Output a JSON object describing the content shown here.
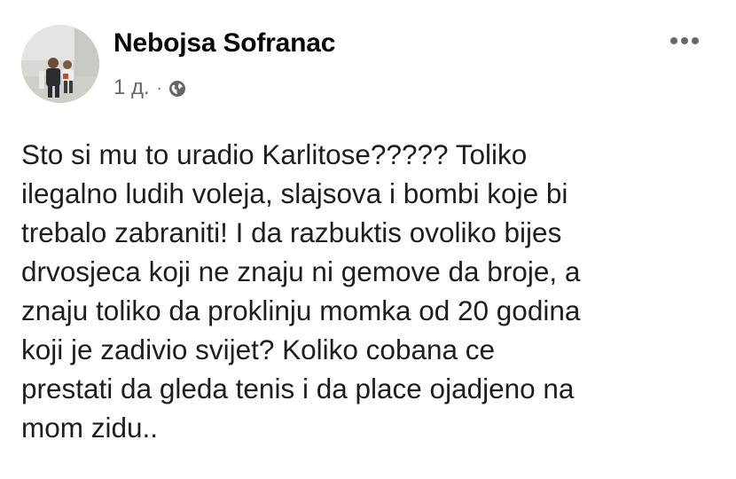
{
  "post": {
    "author": "Nebojsa Sofranac",
    "timestamp": "1 д.",
    "separator": "·",
    "privacy_icon": "globe-icon",
    "more_icon": "more-options-icon",
    "text_lines": [
      "Sto si mu to uradio Karlitose????? Toliko",
      "ilegalno ludih voleja, slajsova i bombi koje bi",
      "trebalo zabraniti! I da razbuktis ovoliko bijes",
      "drvosjeca koji ne znaju ni gemove da broje, a",
      "znaju toliko da proklinju momka od 20 godina",
      "koji je zadivio svijet? Koliko cobana ce",
      "prestati da gleda tenis i da place ojadjeno na",
      "mom zidu.."
    ]
  },
  "colors": {
    "text": "#1c1e21",
    "secondary": "#65676b",
    "background": "#ffffff"
  }
}
